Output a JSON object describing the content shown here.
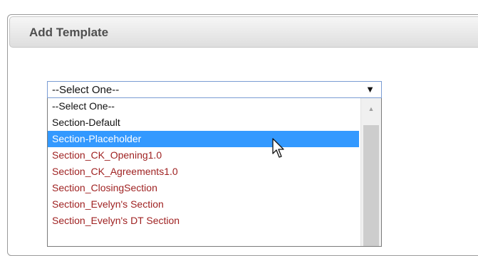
{
  "dialog": {
    "title": "Add Template"
  },
  "template_select": {
    "value": "--Select One--",
    "arrow": "▼"
  },
  "dropdown": {
    "options": [
      {
        "label": "--Select One--"
      },
      {
        "label": "Section-Default"
      },
      {
        "label": "Section-Placeholder",
        "selected": true
      },
      {
        "label": "Section_CK_Opening1.0"
      },
      {
        "label": "Section_CK_Agreements1.0"
      },
      {
        "label": "Section_ClosingSection"
      },
      {
        "label": "Section_Evelyn's Section"
      },
      {
        "label": "Section_Evelyn's DT Section"
      }
    ],
    "scroll_up": "▲"
  },
  "colors": {
    "selected_bg": "#3399ff",
    "custom_option_text": "#9e1f1f",
    "select_border": "#7a9cd3"
  },
  "icons": {
    "cursor": "mouse-pointer-icon"
  }
}
